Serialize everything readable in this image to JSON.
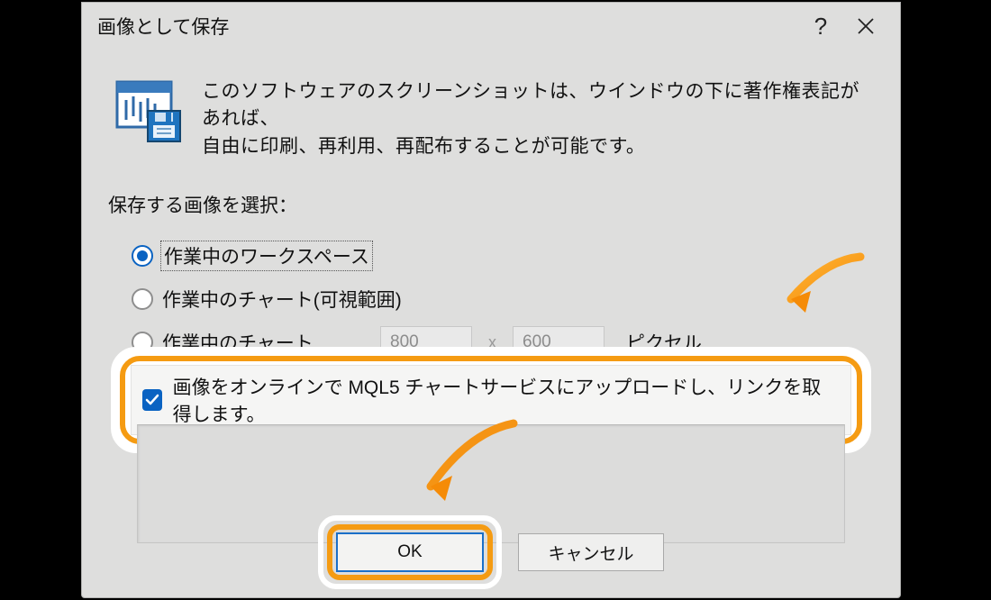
{
  "dialog": {
    "title": "画像として保存",
    "intro_line1": "このソフトウェアのスクリーンショットは、ウインドウの下に著作権表記があれば、",
    "intro_line2": "自由に印刷、再利用、再配布することが可能です。",
    "section_label": "保存する画像を選択：",
    "options": {
      "opt1": "作業中のワークスペース",
      "opt2": "作業中のチャート(可視範囲)",
      "opt3": "作業中のチャート",
      "width": "800",
      "height": "600",
      "px_label": "ピクセル",
      "selected": "opt1"
    },
    "upload_checkbox": {
      "checked": true,
      "label": "画像をオンラインで MQL5 チャートサービスにアップロードし、リンクを取得します。"
    },
    "buttons": {
      "ok": "OK",
      "cancel": "キャンセル"
    }
  }
}
